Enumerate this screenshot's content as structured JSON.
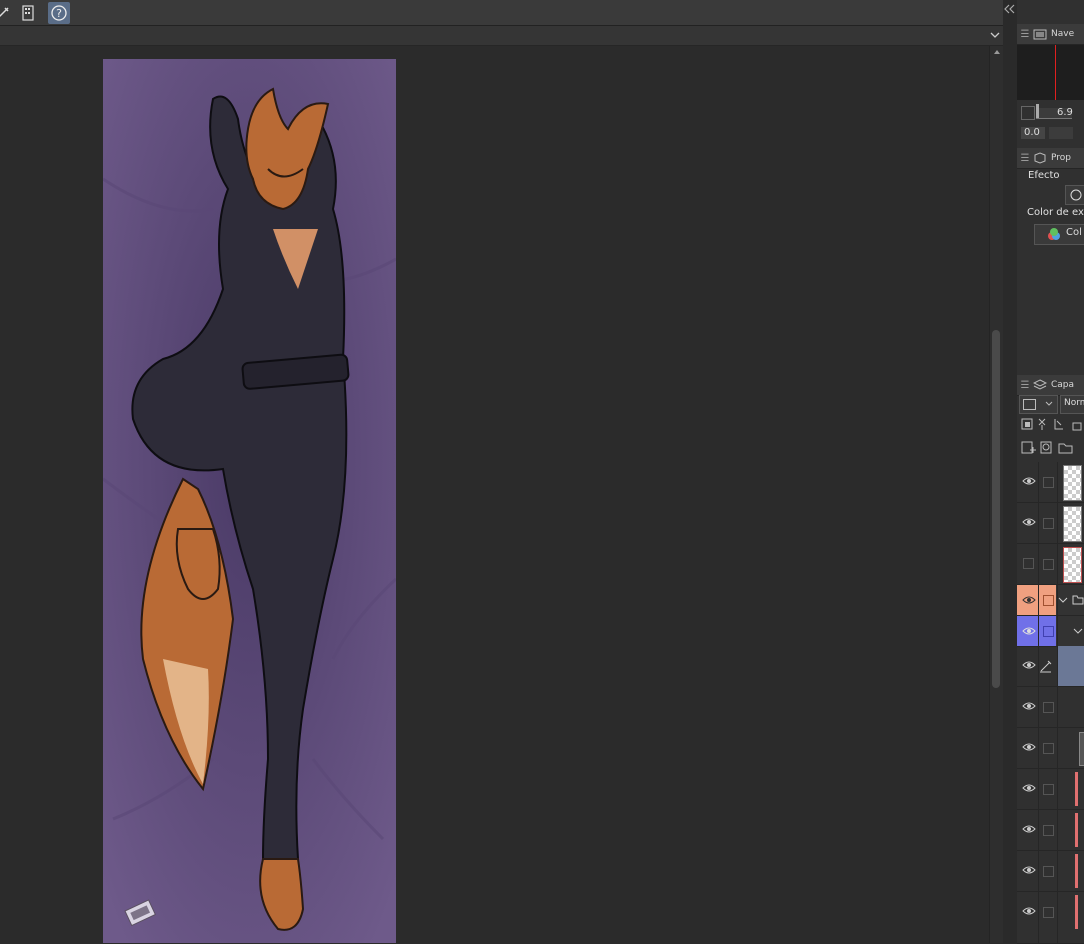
{
  "toolbar": {
    "buttons": [
      "pen-icon",
      "book-icon",
      "help-icon"
    ]
  },
  "navigator": {
    "title": "Nave",
    "zoom_value": "6.9",
    "rotation_value": "0.0"
  },
  "properties": {
    "title": "Prop",
    "effect_label": "Efecto",
    "expression_color_label": "Color de exp",
    "color_button": "Col"
  },
  "layers": {
    "title": "Capa",
    "blend_mode": "Norm",
    "rows": [
      {
        "color": "",
        "visible": true
      },
      {
        "color": "",
        "visible": true
      },
      {
        "color": "",
        "visible": false
      },
      {
        "color": "#f0a080",
        "visible": true
      },
      {
        "color": "#7070e8",
        "visible": true
      },
      {
        "color": "",
        "visible": true
      },
      {
        "color": "",
        "visible": true
      },
      {
        "color": "",
        "visible": true
      },
      {
        "color": "",
        "visible": true
      },
      {
        "color": "",
        "visible": true
      },
      {
        "color": "",
        "visible": true
      },
      {
        "color": "",
        "visible": true
      }
    ]
  },
  "colors": {
    "accent": "#5a6d88",
    "artwork_bg": "#6a5684",
    "layer_red": "#e07070"
  }
}
